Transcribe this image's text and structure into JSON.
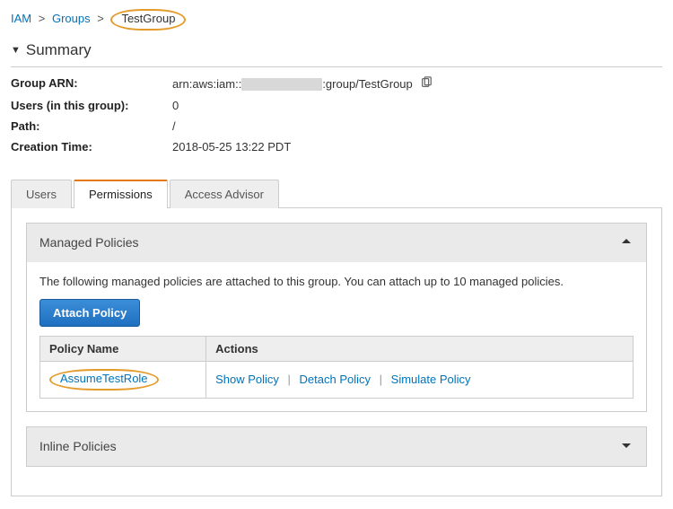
{
  "breadcrumb": {
    "root": "IAM",
    "section": "Groups",
    "current": "TestGroup"
  },
  "summary": {
    "heading": "Summary",
    "arn_label": "Group ARN:",
    "arn_prefix": "arn:aws:iam::",
    "arn_suffix": ":group/TestGroup",
    "users_label": "Users (in this group):",
    "users_value": "0",
    "path_label": "Path:",
    "path_value": "/",
    "creation_label": "Creation Time:",
    "creation_value": "2018-05-25 13:22 PDT"
  },
  "tabs": {
    "users": "Users",
    "permissions": "Permissions",
    "advisor": "Access Advisor"
  },
  "managed": {
    "title": "Managed Policies",
    "desc": "The following managed policies are attached to this group. You can attach up to 10 managed policies.",
    "attach_btn": "Attach Policy",
    "col_name": "Policy Name",
    "col_actions": "Actions",
    "policy_name": "AssumeTestRole",
    "action_show": "Show Policy",
    "action_detach": "Detach Policy",
    "action_simulate": "Simulate Policy"
  },
  "inline": {
    "title": "Inline Policies"
  }
}
